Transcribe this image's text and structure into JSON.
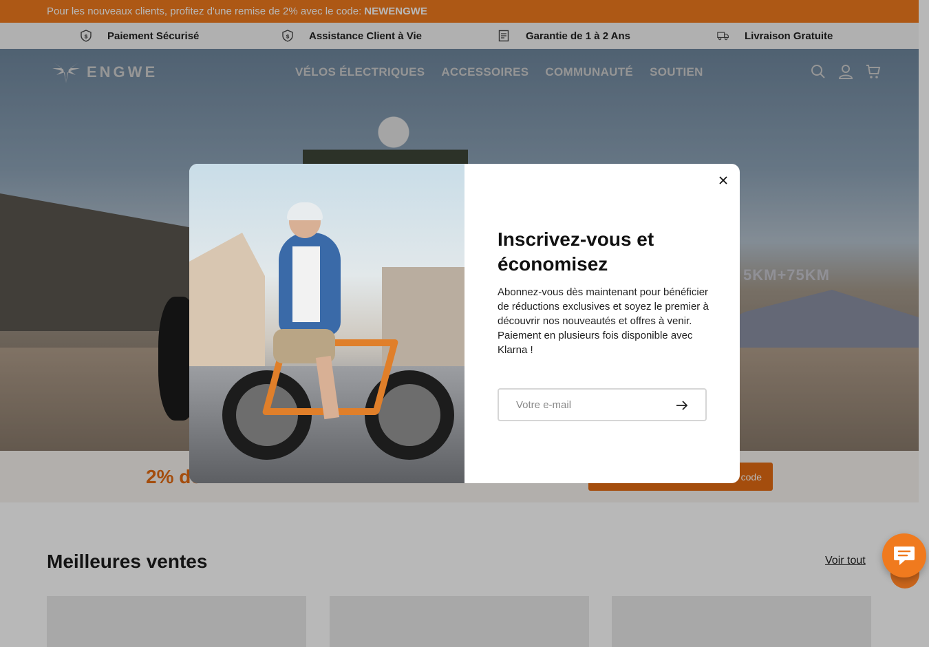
{
  "promo_bar": {
    "text": "Pour les nouveaux clients, profitez d'une remise de 2% avec le code:",
    "code": "NEWENGWE"
  },
  "features": [
    {
      "label": "Paiement Sécurisé",
      "icon": "shield-dollar-icon"
    },
    {
      "label": "Assistance Client à Vie",
      "icon": "shield-dollar-icon"
    },
    {
      "label": "Garantie de 1 à 2 Ans",
      "icon": "invoice-icon"
    },
    {
      "label": "Livraison Gratuite",
      "icon": "truck-icon"
    }
  ],
  "header": {
    "logo_text": "ENGWE",
    "nav": [
      "VÉLOS ÉLECTRIQUES",
      "ACCESSOIRES",
      "COMMUNAUTÉ",
      "SOUTIEN"
    ],
    "icons": [
      "search-icon",
      "account-icon",
      "cart-icon"
    ]
  },
  "hero": {
    "range_text": "5KM+75KM"
  },
  "promo_strip": {
    "text": "2% de",
    "button": "code"
  },
  "bestsellers": {
    "title": "Meilleures ventes",
    "see_all": "Voir tout"
  },
  "modal": {
    "title": "Inscrivez-vous et économisez",
    "description_line1": "Abonnez-vous dès maintenant pour bénéficier de réductions exclusives et soyez le premier à découvrir nos nouveautés et offres à venir.",
    "description_line2": "Paiement en plusieurs fois disponible avec Klarna !",
    "email_placeholder": "Votre e-mail"
  },
  "colors": {
    "accent": "#f07a1e",
    "accent_dark": "#e36b12"
  }
}
